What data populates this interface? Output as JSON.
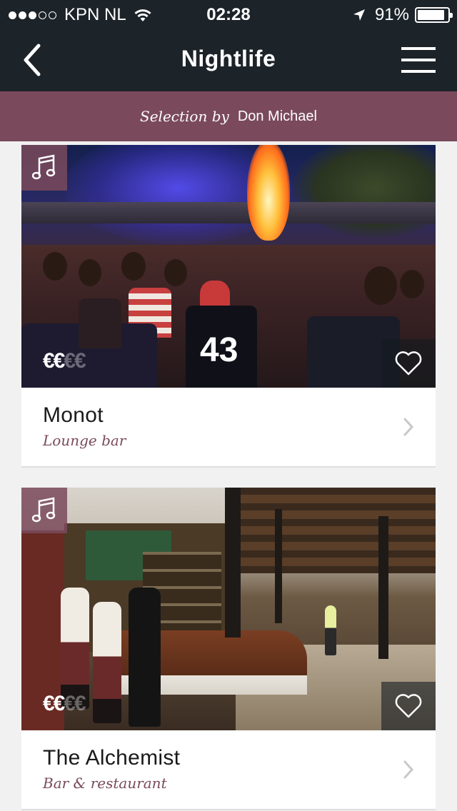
{
  "status_bar": {
    "carrier": "KPN NL",
    "time": "02:28",
    "battery_percent": "91%",
    "battery_level": 0.91,
    "signal_bars_filled": 3,
    "signal_bars_total": 5
  },
  "nav": {
    "title": "Nightlife",
    "back_icon": "chevron-left-icon",
    "menu_icon": "hamburger-menu-icon"
  },
  "banner": {
    "prefix": "Selection by",
    "curator": "Don Michael"
  },
  "colors": {
    "nav_bg": "#1c2329",
    "accent": "#7a4a5c"
  },
  "venues": [
    {
      "name": "Monot",
      "type": "Lounge bar",
      "price_active": "€€",
      "price_inactive": "€€",
      "price_level": 2,
      "price_max": 4,
      "category_icon": "music-note-icon",
      "favorite_icon": "heart-outline-icon",
      "jersey_text": "43"
    },
    {
      "name": "The Alchemist",
      "type": "Bar & restaurant",
      "price_active": "€€",
      "price_inactive": "€€",
      "price_level": 2,
      "price_max": 4,
      "category_icon": "music-note-icon",
      "favorite_icon": "heart-outline-icon"
    }
  ]
}
